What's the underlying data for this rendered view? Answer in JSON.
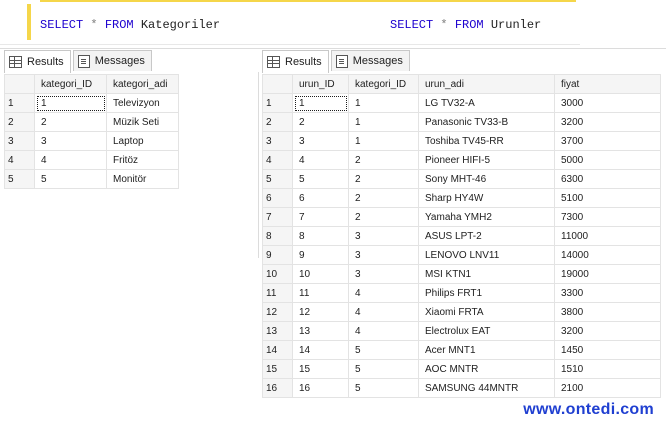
{
  "editor": {
    "query1": {
      "select": "SELECT",
      "star": "*",
      "from": "FROM",
      "table": "Kategoriler"
    },
    "query2": {
      "select": "SELECT",
      "star": "*",
      "from": "FROM",
      "table": "Urunler"
    }
  },
  "left_pane": {
    "tabs": [
      {
        "label": "Results",
        "icon": "grid-icon"
      },
      {
        "label": "Messages",
        "icon": "messages-icon"
      }
    ],
    "columns": [
      "kategori_ID",
      "kategori_adi"
    ],
    "rows": [
      [
        "1",
        "1",
        "Televizyon"
      ],
      [
        "2",
        "2",
        "Müzik Seti"
      ],
      [
        "3",
        "3",
        "Laptop"
      ],
      [
        "4",
        "4",
        "Fritöz"
      ],
      [
        "5",
        "5",
        "Monitör"
      ]
    ]
  },
  "right_pane": {
    "tabs": [
      {
        "label": "Results",
        "icon": "grid-icon"
      },
      {
        "label": "Messages",
        "icon": "messages-icon"
      }
    ],
    "columns": [
      "urun_ID",
      "kategori_ID",
      "urun_adi",
      "fiyat"
    ],
    "rows": [
      [
        "1",
        "1",
        "1",
        "LG TV32-A",
        "3000"
      ],
      [
        "2",
        "2",
        "1",
        "Panasonic TV33-B",
        "3200"
      ],
      [
        "3",
        "3",
        "1",
        "Toshiba TV45-RR",
        "3700"
      ],
      [
        "4",
        "4",
        "2",
        "Pioneer HIFI-5",
        "5000"
      ],
      [
        "5",
        "5",
        "2",
        "Sony MHT-46",
        "6300"
      ],
      [
        "6",
        "6",
        "2",
        "Sharp HY4W",
        "5100"
      ],
      [
        "7",
        "7",
        "2",
        "Yamaha YMH2",
        "7300"
      ],
      [
        "8",
        "8",
        "3",
        "ASUS LPT-2",
        "11000"
      ],
      [
        "9",
        "9",
        "3",
        "LENOVO LNV11",
        "14000"
      ],
      [
        "10",
        "10",
        "3",
        "MSI KTN1",
        "19000"
      ],
      [
        "11",
        "11",
        "4",
        "Philips FRT1",
        "3300"
      ],
      [
        "12",
        "12",
        "4",
        "Xiaomi FRTA",
        "3800"
      ],
      [
        "13",
        "13",
        "4",
        "Electrolux EAT",
        "3200"
      ],
      [
        "14",
        "14",
        "5",
        "Acer MNT1",
        "1450"
      ],
      [
        "15",
        "15",
        "5",
        "AOC MNTR",
        "1510"
      ],
      [
        "16",
        "16",
        "5",
        "SAMSUNG 44MNTR",
        "2100"
      ]
    ]
  },
  "watermark": "www.ontedi.com"
}
